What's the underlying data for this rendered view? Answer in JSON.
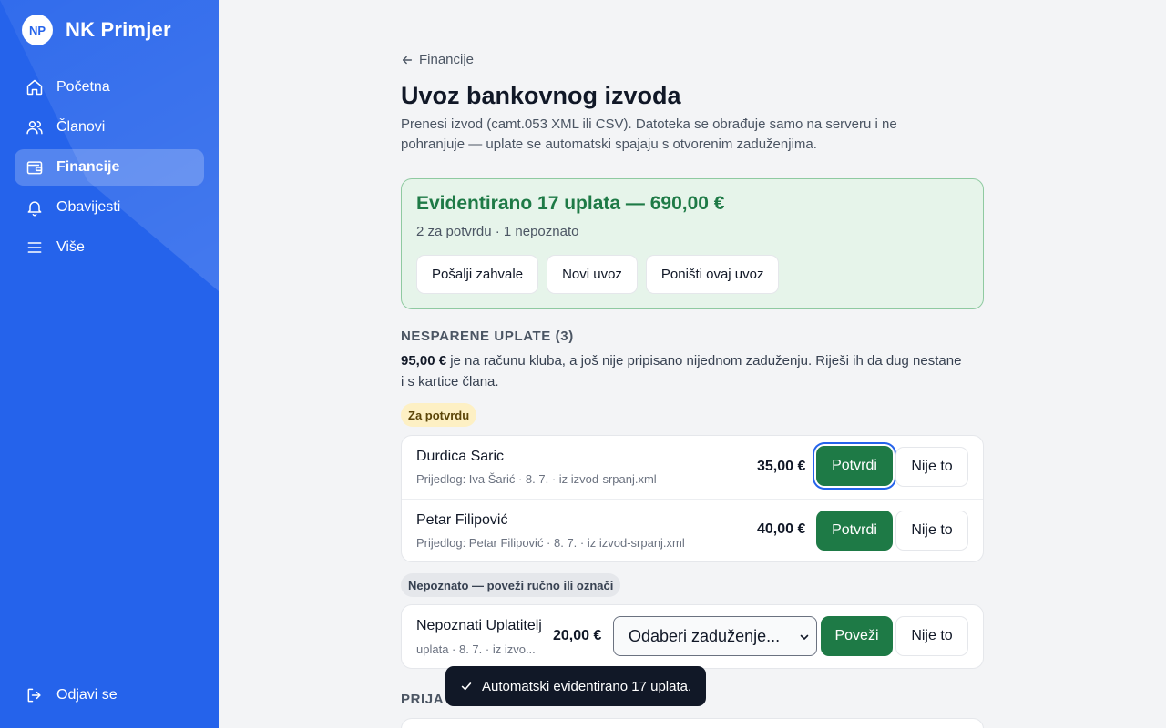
{
  "app": {
    "badge": "NP",
    "name": "NK Primjer"
  },
  "sidebar": {
    "items": [
      {
        "label": "Početna",
        "icon": "home-icon"
      },
      {
        "label": "Članovi",
        "icon": "users-icon"
      },
      {
        "label": "Financije",
        "icon": "wallet-icon",
        "active": true
      },
      {
        "label": "Obavijesti",
        "icon": "bell-icon"
      },
      {
        "label": "Više",
        "icon": "menu-icon"
      }
    ],
    "logout": "Odjavi se"
  },
  "page": {
    "back": "Financije",
    "title": "Uvoz bankovnog izvoda",
    "description": "Prenesi izvod (camt.053 XML ili CSV). Datoteka se obrađuje samo na serveru i ne pohranjuje — uplate se automatski spajaju s otvorenim zaduženjima."
  },
  "summary": {
    "title": "Evidentirano 17 uplata — 690,00 €",
    "subtitle": "2 za potvrdu · 1 nepoznato",
    "actions": [
      "Pošalji zahvale",
      "Novi uvoz",
      "Poništi ovaj uvoz"
    ]
  },
  "unmatched": {
    "heading": "NESPARENE UPLATE (3)",
    "amount": "95,00 €",
    "text": " je na računu kluba, a još nije pripisano nijednom zaduženju. Riješi ih da dug nestane i s kartice člana.",
    "to_confirm_label": "Za potvrdu",
    "to_confirm": [
      {
        "name": "Durdica Saric",
        "meta": "Prijedlog: Iva Šarić · 8. 7. · iz izvod-srpanj.xml",
        "amount": "35,00 €",
        "confirm": "Potvrdi",
        "reject": "Nije to"
      },
      {
        "name": "Petar Filipović",
        "meta": "Prijedlog: Petar Filipović · 8. 7. · iz izvod-srpanj.xml",
        "amount": "40,00 €",
        "confirm": "Potvrdi",
        "reject": "Nije to"
      }
    ],
    "unknown_label": "Nepoznato — poveži ručno ili označi",
    "unknown": [
      {
        "name": "Nepoznati Uplatitelj",
        "meta": "uplata · 8. 7. · iz izvo...",
        "amount": "20,00 €",
        "select": "Odaberi zaduženje...",
        "link": "Poveži",
        "reject": "Nije to"
      }
    ]
  },
  "next_section": {
    "heading": "PRIJA"
  },
  "toast": {
    "text": "Automatski evidentirano 17 uplata.",
    "icon": "check-icon"
  },
  "colors": {
    "sidebar": "#2563eb",
    "success_bg": "#e6f4ea",
    "success_text": "#1e7a46",
    "primary_button": "#1e7a46",
    "warn_pill": "#fdf0c4",
    "toast_bg": "#111827"
  }
}
